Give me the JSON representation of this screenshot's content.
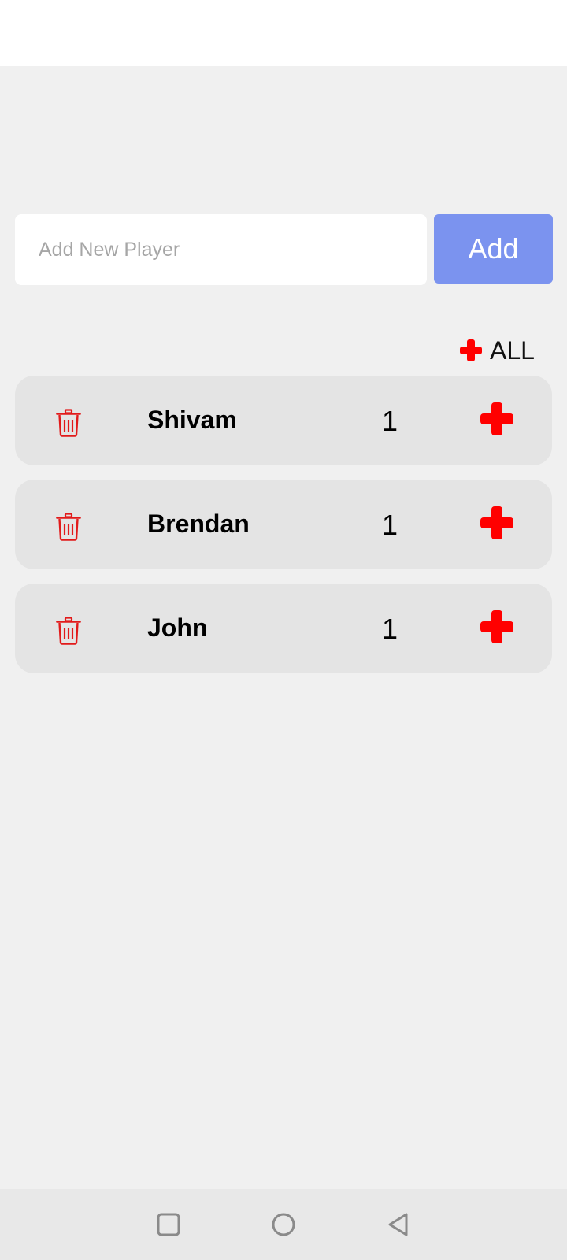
{
  "add_player": {
    "placeholder": "Add New Player",
    "value": "",
    "button_label": "Add"
  },
  "all": {
    "label": "ALL",
    "icon": "plus-icon"
  },
  "players": [
    {
      "name": "Shivam",
      "score": "1"
    },
    {
      "name": "Brendan",
      "score": "1"
    },
    {
      "name": "John",
      "score": "1"
    }
  ],
  "nav_bar": {
    "buttons": [
      "recents-square-icon",
      "home-circle-icon",
      "back-triangle-icon"
    ]
  },
  "colors": {
    "accent": "#7b93ef",
    "icon_red": "#ff0000",
    "trash_red": "#e21a1a",
    "card_bg": "#e4e4e4",
    "page_bg": "#f0f0f0"
  }
}
